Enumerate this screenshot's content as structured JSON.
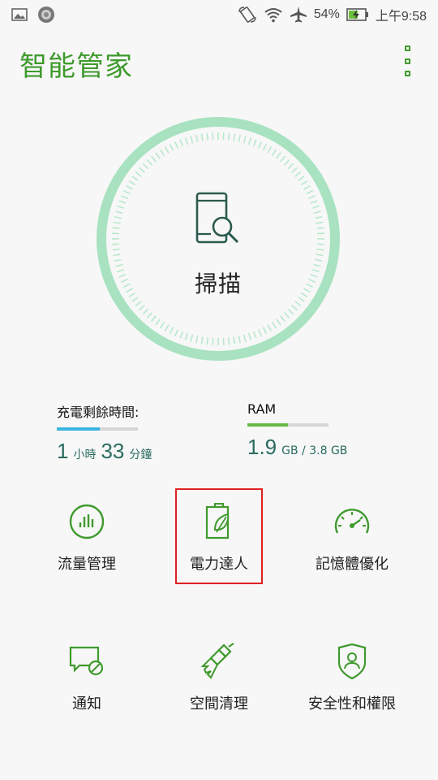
{
  "status_bar": {
    "battery_percent": "54%",
    "time": "上午9:58",
    "icons": [
      "image-icon",
      "circle-app-icon",
      "rotate-icon",
      "wifi-icon",
      "airplane-icon",
      "battery-charging-icon"
    ]
  },
  "header": {
    "title": "智能管家"
  },
  "scan": {
    "label": "掃描",
    "ring_color": "#9fe0bb"
  },
  "stats": {
    "charge": {
      "label": "充電剩餘時間:",
      "hours": "1",
      "hours_unit": "小時",
      "minutes": "33",
      "minutes_unit": "分鐘",
      "bar_fraction": 0.53,
      "bar_color": "#3ab4e0"
    },
    "ram": {
      "label": "RAM",
      "used": "1.9",
      "total_text": "GB / 3.8 GB",
      "bar_fraction": 0.5,
      "bar_color": "#66bb44"
    }
  },
  "tools": [
    {
      "label": "流量管理",
      "icon": "data-usage-icon"
    },
    {
      "label": "電力達人",
      "icon": "battery-leaf-icon"
    },
    {
      "label": "記憶體優化",
      "icon": "speedometer-icon"
    },
    {
      "label": "通知",
      "icon": "notification-block-icon"
    },
    {
      "label": "空間清理",
      "icon": "broom-icon"
    },
    {
      "label": "安全性和權限",
      "icon": "shield-user-icon"
    }
  ],
  "colors": {
    "accent": "#3f9a2d",
    "text_teal": "#2a6b5e",
    "highlight": "#e02020"
  }
}
